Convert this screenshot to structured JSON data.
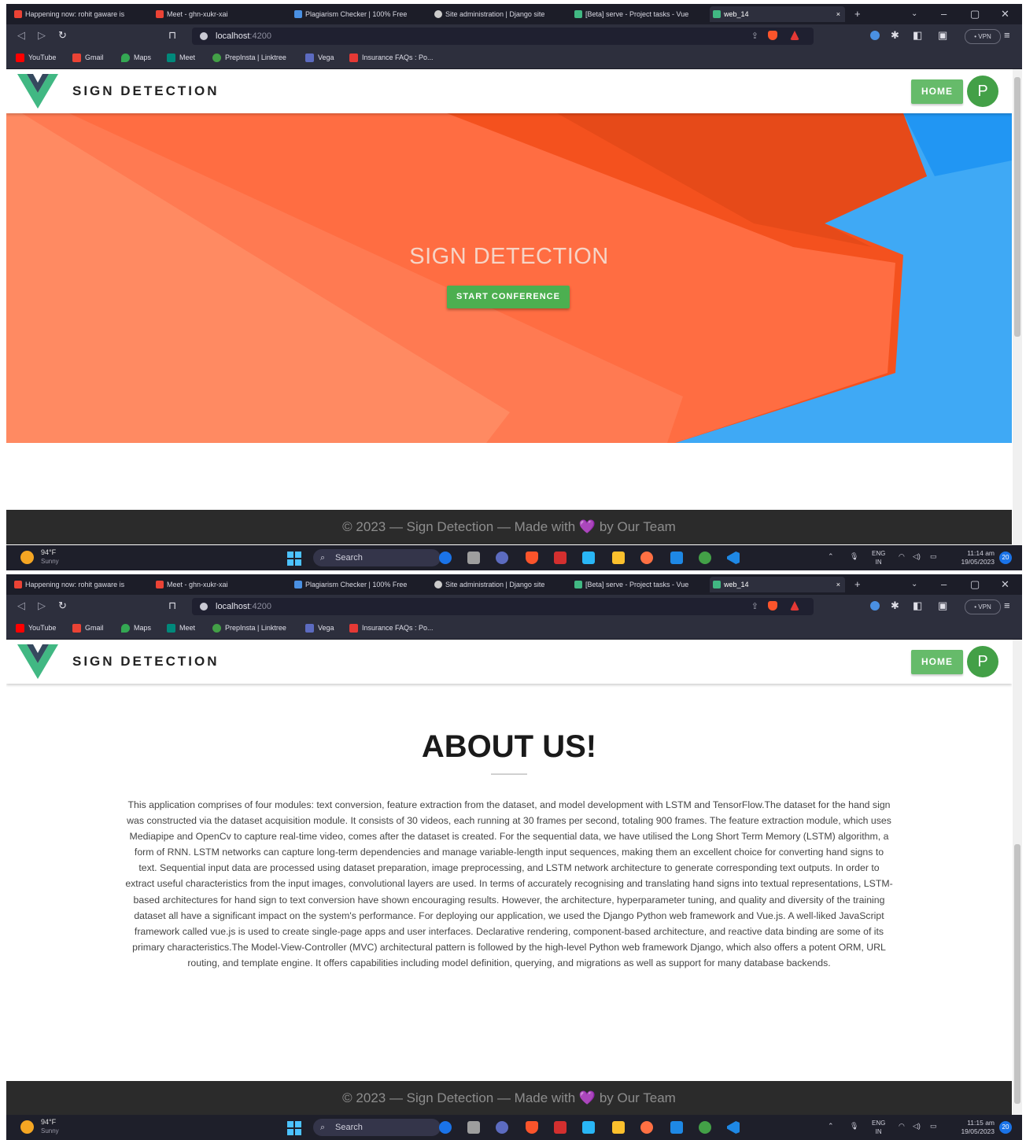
{
  "browser": {
    "tabs": [
      {
        "label": "Happening now: rohit gaware is",
        "color": "#ea4335"
      },
      {
        "label": "Meet - ghn-xukr-xai",
        "color": "#ea4335"
      },
      {
        "label": "Plagiarism Checker | 100% Free",
        "color": "#4a90e2"
      },
      {
        "label": "Site administration | Django site",
        "color": "#cccccc"
      },
      {
        "label": "[Beta] serve - Project tasks - Vue",
        "color": "#41b883"
      },
      {
        "label": "web_14",
        "color": "#41b883"
      }
    ],
    "url_host": "localhost",
    "url_port": ":4200",
    "vpn_label": "• VPN",
    "bookmarks": [
      {
        "label": "YouTube",
        "color": "#ff0000"
      },
      {
        "label": "Gmail",
        "color": "#ea4335"
      },
      {
        "label": "Maps",
        "color": "#34a853"
      },
      {
        "label": "Meet",
        "color": "#00897b"
      },
      {
        "label": "PrepInsta | Linktree",
        "color": "#43a047"
      },
      {
        "label": "Vega",
        "color": "#5c6bc0"
      },
      {
        "label": "Insurance FAQs : Po...",
        "color": "#e53935"
      }
    ]
  },
  "app": {
    "brand": "SIGN DETECTION",
    "home_button": "HOME",
    "avatar_letter": "P",
    "hero_title": "SIGN DETECTION",
    "hero_button": "START CONFERENCE",
    "footer_left": "© 2023 — Sign Detection — Made with",
    "footer_heart": "💜",
    "footer_right": "by Our Team",
    "about_title": "ABOUT US!",
    "about_text": "This application comprises of four modules: text conversion, feature extraction from the dataset, and model development with LSTM and TensorFlow.The dataset for the hand sign was constructed via the dataset acquisition module. It consists of 30 videos, each running at 30 frames per second, totaling 900 frames. The feature extraction module, which uses Mediapipe and OpenCv to capture real-time video, comes after the dataset is created. For the sequential data, we have utilised the Long Short Term Memory (LSTM) algorithm, a form of RNN. LSTM networks can capture long-term dependencies and manage variable-length input sequences, making them an excellent choice for converting hand signs to text. Sequential input data are processed using dataset preparation, image preprocessing, and LSTM network architecture to generate corresponding text outputs. In order to extract useful characteristics from the input images, convolutional layers are used. In terms of accurately recognising and translating hand signs into textual representations, LSTM-based architectures for hand sign to text conversion have shown encouraging results. However, the architecture, hyperparameter tuning, and quality and diversity of the training dataset all have a significant impact on the system's performance. For deploying our application, we used the Django Python web framework and Vue.js. A well-liked JavaScript framework called vue.js is used to create single-page apps and user interfaces. Declarative rendering, component-based architecture, and reactive data binding are some of its primary characteristics.The Model-View-Controller (MVC) architectural pattern is followed by the high-level Python web framework Django, which also offers a potent ORM, URL routing, and template engine. It offers capabilities including model definition, querying, and migrations as well as support for many database backends."
  },
  "colors": {
    "accent_green": "#66bb6a",
    "hero_orange": "#f4511e",
    "hero_blue": "#3fa9f5"
  },
  "taskbar": {
    "temp": "94°F",
    "condition": "Sunny",
    "search": "Search",
    "lang": "ENG",
    "region": "IN",
    "date": "19/05/2023",
    "time_first": "11:14 am",
    "time_second": "11:15 am",
    "notif_count": "20"
  }
}
